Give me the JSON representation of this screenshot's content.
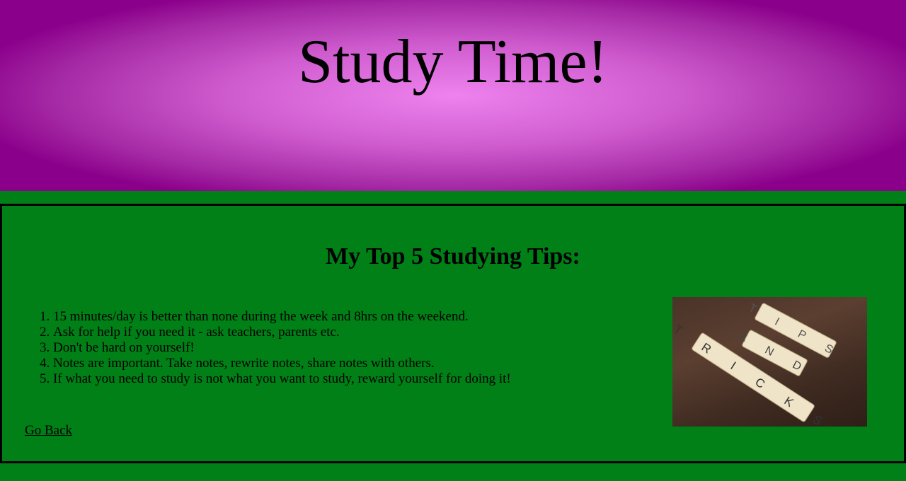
{
  "header": {
    "title": "Study Time!"
  },
  "content": {
    "heading": "My Top 5 Studying Tips:",
    "tips": [
      "15 minutes/day is better than none during the week and 8hrs on the weekend.",
      "Ask for help if you need it - ask teachers, parents etc.",
      "Don't be hard on yourself!",
      "Notes are important. Take notes, rewrite notes, share notes with others.",
      "If what you need to study is not what you want to study, reward yourself for doing it!"
    ],
    "back_link": "Go Back",
    "image": {
      "tiles": [
        "T I P S",
        "A N D",
        "T R I C K S"
      ]
    }
  }
}
